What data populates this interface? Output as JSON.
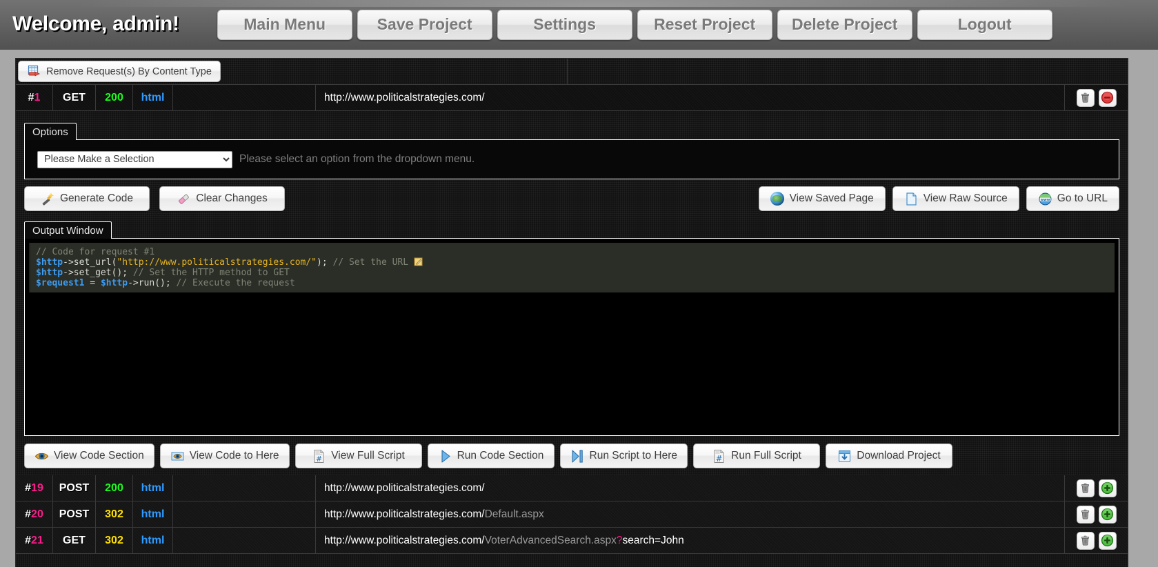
{
  "topbar": {
    "welcome": "Welcome, admin!",
    "nav": [
      {
        "label": "Main Menu",
        "name": "main-menu"
      },
      {
        "label": "Save Project",
        "name": "save-project"
      },
      {
        "label": "Settings",
        "name": "settings"
      },
      {
        "label": "Reset Project",
        "name": "reset-project"
      },
      {
        "label": "Delete Project",
        "name": "delete-project"
      },
      {
        "label": "Logout",
        "name": "logout"
      }
    ]
  },
  "toolbar": {
    "remove_by_content_type": "Remove Request(s) By Content Type",
    "remove_icon": "table-remove-icon"
  },
  "selected_request": {
    "hash": "#",
    "index": "1",
    "method": "GET",
    "status": "200",
    "content_type": "html",
    "url_domain": "http://www.politicalstrategies.com/",
    "url_path": "",
    "delete_icon": "trash-icon",
    "collapse_icon": "red-minus-icon"
  },
  "options_tab": {
    "tab_label": "Options",
    "select_value": "Please Make a Selection",
    "select_options": [
      "Please Make a Selection"
    ],
    "hint": "Please select an option from the dropdown menu."
  },
  "actions": {
    "generate_code": "Generate Code",
    "generate_code_icon": "magic-wand-icon",
    "clear_changes": "Clear Changes",
    "clear_changes_icon": "eraser-icon",
    "view_saved_page": "View Saved Page",
    "view_saved_page_icon": "globe-icon",
    "view_raw_source": "View Raw Source",
    "view_raw_source_icon": "page-icon",
    "go_to_url": "Go to URL",
    "go_to_url_icon": "www-globe-icon"
  },
  "output_tab": {
    "tab_label": "Output Window",
    "code_lines": [
      {
        "comment": "// Code for request #1"
      },
      {
        "var": "$http",
        "op": "->",
        "fn": "set_url(",
        "str": "\"http://www.politicalstrategies.com/\"",
        "tail": ");",
        "comment": " // Set the URL",
        "edit_icon": "pencil-edit-icon"
      },
      {
        "var": "$http",
        "op": "->",
        "fn": "set_get();",
        "comment": " // Set the HTTP method to GET"
      },
      {
        "var": "$request1",
        "op": " = ",
        "var2": "$http",
        "op2": "->",
        "fn": "run();",
        "comment": " // Execute the request"
      }
    ]
  },
  "bottom_actions": [
    {
      "label": "View Code Section",
      "name": "view-code-section",
      "icon": "eye-icon"
    },
    {
      "label": "View Code to Here",
      "name": "view-code-to-here",
      "icon": "eye-marker-icon"
    },
    {
      "label": "View Full Script",
      "name": "view-full-script",
      "icon": "script-page-icon"
    },
    {
      "label": "Run Code Section",
      "name": "run-code-section",
      "icon": "play-icon"
    },
    {
      "label": "Run Script to Here",
      "name": "run-script-to-here",
      "icon": "play-to-end-icon"
    },
    {
      "label": "Run Full Script",
      "name": "run-full-script",
      "icon": "script-run-icon"
    },
    {
      "label": "Download Project",
      "name": "download-project",
      "icon": "download-icon"
    }
  ],
  "request_rows": [
    {
      "hash": "#",
      "index": "19",
      "method": "POST",
      "status": "200",
      "status_class": "c200",
      "content_type": "html",
      "url_domain": "http://www.politicalstrategies.com/",
      "url_path": "",
      "url_query_mark": "",
      "url_query": "",
      "delete_icon": "trash-icon",
      "expand_icon": "green-plus-icon"
    },
    {
      "hash": "#",
      "index": "20",
      "method": "POST",
      "status": "302",
      "status_class": "c302",
      "content_type": "html",
      "url_domain": "http://www.politicalstrategies.com/",
      "url_path": "Default.aspx",
      "url_query_mark": "",
      "url_query": "",
      "delete_icon": "trash-icon",
      "expand_icon": "green-plus-icon"
    },
    {
      "hash": "#",
      "index": "21",
      "method": "GET",
      "status": "302",
      "status_class": "c302",
      "content_type": "html",
      "url_domain": "http://www.politicalstrategies.com/",
      "url_path": "VoterAdvancedSearch.aspx",
      "url_query_mark": "?",
      "url_query": "search=John",
      "delete_icon": "trash-icon",
      "expand_icon": "green-plus-icon"
    }
  ],
  "colors": {
    "accent_pink": "#ff1a8c",
    "status_ok": "#1aff1a",
    "status_redirect": "#ffe000",
    "content_type": "#2e9bff",
    "chrome": "#6d6d6d"
  }
}
